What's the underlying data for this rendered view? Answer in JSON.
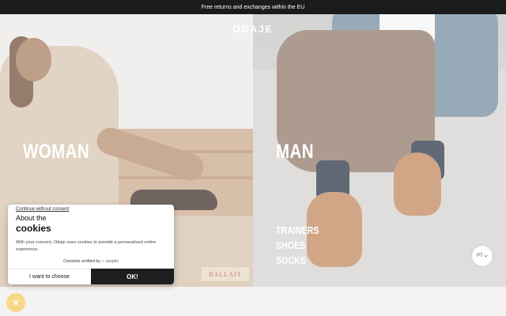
{
  "announcement": "Free returns and exchanges within the EU",
  "brand": "ODAJE",
  "categories": {
    "woman": "WOMAN",
    "man": "MAN"
  },
  "man_links": [
    "TRAINERS",
    "SHOES",
    "SOCKS"
  ],
  "background_sign": "BALLAIT",
  "language": {
    "code": "PT",
    "chevron": "chevron-down-icon"
  },
  "cookie_banner": {
    "continue_link": "Continue without consent",
    "about": "About the",
    "title": "cookies",
    "description": "With your consent, Odaje uses cookies to provide a personalized online experience.",
    "certified_text": "Consents certified by",
    "certifier": "✓ axeptio",
    "choose_button": "I want to choose",
    "ok_button": "OK!"
  },
  "close_icon": "close-icon",
  "colors": {
    "topbar": "#1b1b1b",
    "ok_button": "#1e1e1e",
    "close_badge": "#f5d889"
  }
}
